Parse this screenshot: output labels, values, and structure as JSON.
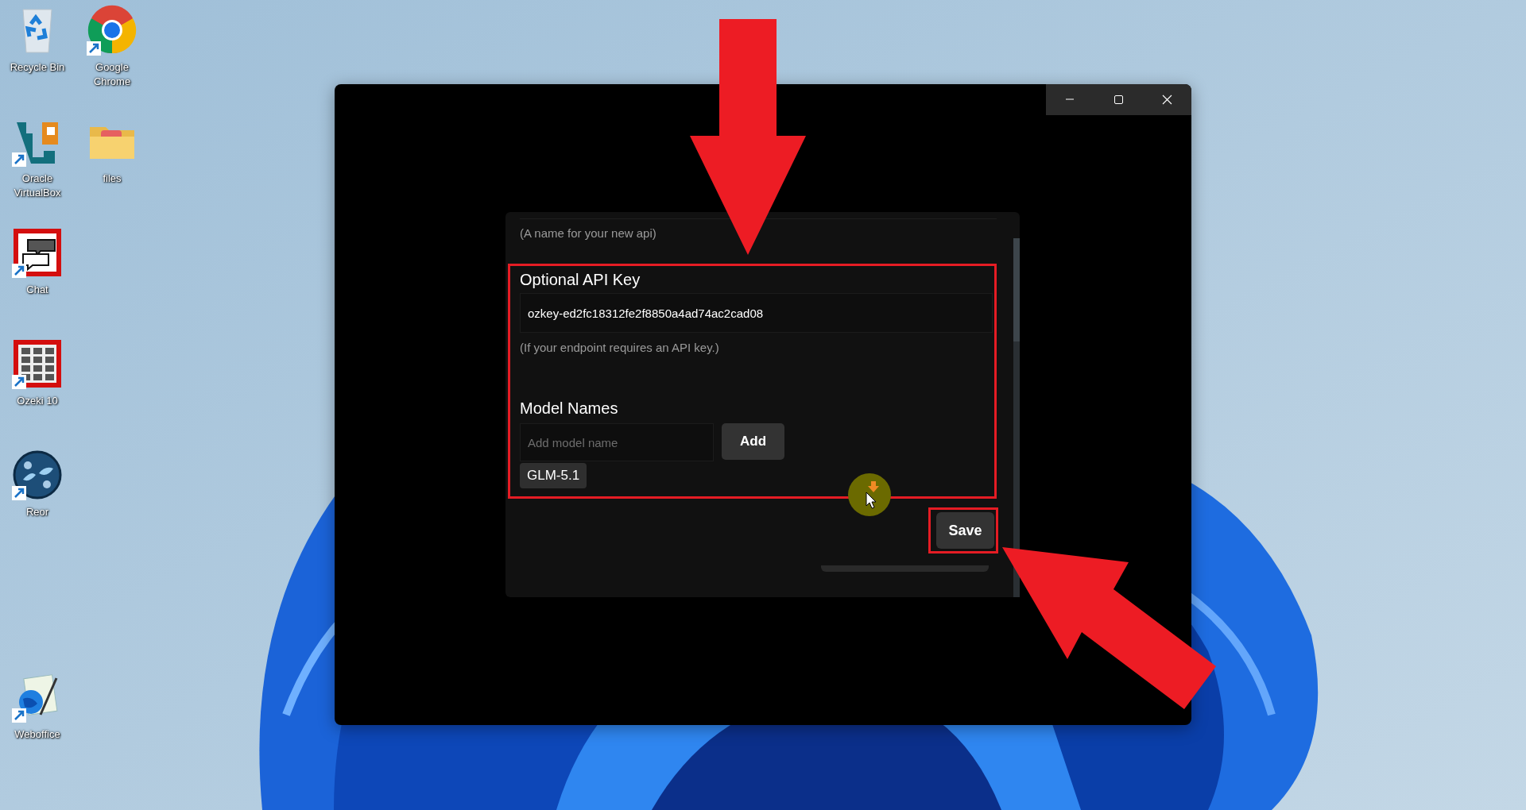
{
  "desktop_icons": [
    {
      "label": "Recycle Bin",
      "kind": "recycle-bin",
      "shortcut": false
    },
    {
      "label": "Google Chrome",
      "kind": "chrome",
      "shortcut": true
    },
    {
      "label": "Oracle VirtualBox",
      "kind": "virtualbox",
      "shortcut": true
    },
    {
      "label": "files",
      "kind": "folder",
      "shortcut": false
    },
    {
      "label": "Chat",
      "kind": "chat",
      "shortcut": true
    },
    {
      "label": "Ozeki 10",
      "kind": "keypad",
      "shortcut": true
    },
    {
      "label": "Reor",
      "kind": "reor",
      "shortcut": true
    },
    {
      "label": "Weboffice",
      "kind": "weboffice",
      "shortcut": true
    }
  ],
  "window": {
    "controls": [
      {
        "kind": "minimize"
      },
      {
        "kind": "maximize"
      },
      {
        "kind": "close"
      }
    ]
  },
  "dialog": {
    "name_hint": "(A name for your new api)",
    "section_highlighted": true,
    "api_key": {
      "label": "Optional API Key",
      "value": "ozkey-ed2fc18312fe2f8850a4ad74ac2cad08",
      "hint": "(If your endpoint requires an API key.)"
    },
    "model_names": {
      "label": "Model Names",
      "placeholder": "Add model name",
      "add_button": "Add",
      "models": [
        "GLM-5.1"
      ]
    },
    "save_button": {
      "label": "Save",
      "highlighted": true
    }
  },
  "annotations": [
    {
      "kind": "arrow-down"
    },
    {
      "kind": "arrow-diagonal"
    }
  ]
}
